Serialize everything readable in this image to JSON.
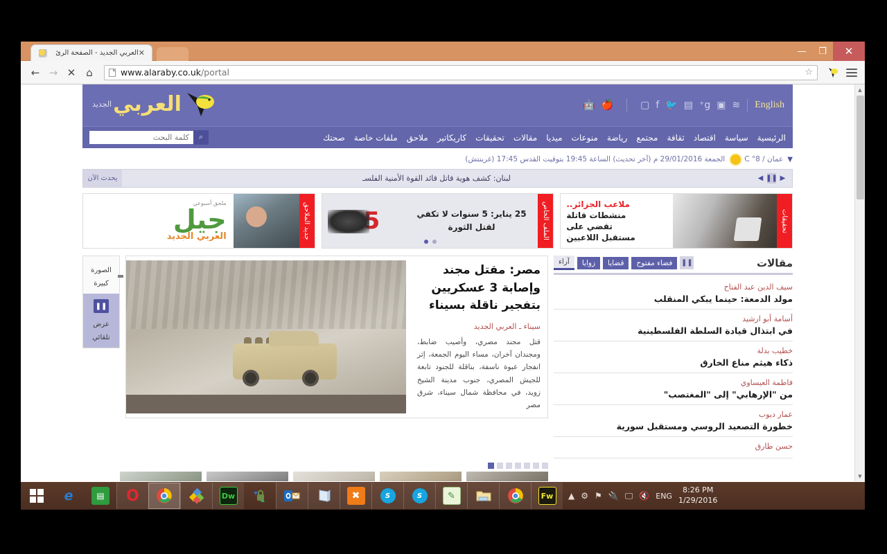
{
  "browser": {
    "tab_title": "العربي الجديد - الصفحة الرئ",
    "tab_close": "✕",
    "url_host": "www.alaraby.co.uk",
    "url_path": "/portal",
    "back": "←",
    "forward": "→",
    "stop": "✕",
    "home": "⌂",
    "minimize": "—",
    "maximize": "❐",
    "close": "✕"
  },
  "site": {
    "lang_link": "English",
    "logo_text": "العربي",
    "logo_sub": "الجديد",
    "social": [
      "rss-icon",
      "instagram-icon",
      "googleplus-icon",
      "youtube-icon",
      "twitter-icon",
      "facebook-icon",
      "camera-icon",
      "apple-icon",
      "android-icon"
    ],
    "social_glyphs": [
      "≈",
      "◙",
      "g+",
      "▶",
      "y",
      "f",
      "◉",
      "",
      "⋔"
    ],
    "nav": [
      "الرئيسية",
      "سياسة",
      "اقتصاد",
      "ثقافة",
      "مجتمع",
      "رياضة",
      "منوعات",
      "ميديا",
      "مقالات",
      "تحقيقات",
      "كاريكاتير",
      "ملاحق",
      "ملفات خاصة",
      "صحتك"
    ],
    "search_placeholder": "كلمة البحث",
    "search_icon": "⌕",
    "date_line": "الجمعة 29/01/2016 م (آخر تحديث) الساعة 19:45 بتوقيت القدس 17:45 (غرينتش)",
    "weather_city": "عمان / 8° C",
    "weather_chevron": "▼"
  },
  "ticker": {
    "label": "يحدث الآن",
    "headline": "لبنان: كشف هوية قاتل قائد القوة الأمنية الفلسـ",
    "prev": "◀",
    "pause": "❚❚",
    "next": "▶"
  },
  "banners": [
    {
      "tab": "تحقيقات",
      "line1": "ملاعب الجزائر..",
      "line2": "منشطات قاتلة",
      "line3": "تقضي على",
      "line4": "مستقبل اللاعبين"
    },
    {
      "tab": "الملف الخاص",
      "text": "25 يناير: 5 سنوات لا تكفي لقتل الثورة",
      "art_number": "25"
    },
    {
      "tab": "جديد الملاحق",
      "name": "جيل",
      "small": "ملحق أسبوعي",
      "logo": "العربي الجديد"
    }
  ],
  "articles": {
    "title": "مقالات",
    "pause": "❚❚",
    "tabs": [
      {
        "label": "آراء",
        "active": true
      },
      {
        "label": "زوايا",
        "active": false
      },
      {
        "label": "قضايا",
        "active": false
      },
      {
        "label": "فضاء مفتوح",
        "active": false
      }
    ],
    "items": [
      {
        "author": "سيف الدين عبد الفتاح",
        "title": "مولد الدمعة: حينما يبكي المنقلب"
      },
      {
        "author": "أسامة أبو ارشيد",
        "title": "في ابتذال قيادة السلطة الفلسطينية"
      },
      {
        "author": "خطيب بدلة",
        "title": "ذكاء هيثم مناع الخارق"
      },
      {
        "author": "فاطمة العيساوي",
        "title": "من \"الإرهابي\" إلى \"المغتصب\""
      },
      {
        "author": "عمار ديوب",
        "title": "خطورة التصعيد الروسي ومستقبل سورية"
      },
      {
        "author": "حسن طارق",
        "title": ""
      }
    ]
  },
  "feature": {
    "headline": "مصر: مقتل مجند وإصابة 3 عسكريين بتفجير ناقلة بسيناء",
    "byline": "سيناء ـ العربي الجديد",
    "body": "قتل مجند مصري، وأصيب ضابط، ومجندان آخران، مساء اليوم الجمعة، إثر انفجار عبوة ناسفة، بناقلة للجنود تابعة للجيش المصري، جنوب مدينة الشيخ زويد، في محافظة شمال سيناء، شرق مصر"
  },
  "rail": {
    "big_image_label": "الصورة كبيرة",
    "autoplay_label": "عرض تلقائي",
    "autoplay_glyph": "❚❚"
  },
  "carousel": {
    "dots_count": 7,
    "active_dot": 7,
    "prev_arrow": "‹",
    "next_arrow": "›"
  },
  "taskbar": {
    "start": "start-button",
    "apps": [
      {
        "name": "internet-explorer",
        "glyph": "e",
        "color": "#2a7bd0",
        "bg": "transparent",
        "active": false
      },
      {
        "name": "windows-store",
        "glyph": "▣",
        "color": "#ffffff",
        "bg": "#2e9b3f",
        "active": false
      },
      {
        "name": "opera",
        "glyph": "O",
        "color": "#ffffff",
        "bg": "#e0282e",
        "active": false
      },
      {
        "name": "google-chrome",
        "glyph": "◉",
        "color": "#ffffff",
        "bg": "#4f9e4f",
        "active": true
      },
      {
        "name": "color-app",
        "glyph": "◆",
        "color": "#ffffff",
        "bg": "#d66a8a",
        "active": false
      },
      {
        "name": "dreamweaver",
        "glyph": "Dw",
        "color": "#3ec93e",
        "bg": "#0d240d",
        "active": false
      },
      {
        "name": "sync-lock",
        "glyph": "🔒",
        "color": "#ffffff",
        "bg": "transparent",
        "active": false
      },
      {
        "name": "outlook",
        "glyph": "O",
        "color": "#ffffff",
        "bg": "#1b6ec2",
        "active": false
      },
      {
        "name": "notepad",
        "glyph": "▤",
        "color": "#6f9fd8",
        "bg": "#dfeaf7",
        "active": false
      },
      {
        "name": "xampp",
        "glyph": "✖",
        "color": "#ffffff",
        "bg": "#f07c18",
        "active": false
      },
      {
        "name": "skype-one",
        "glyph": "S",
        "color": "#ffffff",
        "bg": "#16a5e0",
        "active": false
      },
      {
        "name": "skype-two",
        "glyph": "S",
        "color": "#ffffff",
        "bg": "#16a5e0",
        "active": false
      },
      {
        "name": "notepad-plus-plus",
        "glyph": "✎",
        "color": "#3b8c3b",
        "bg": "#e8f2d8",
        "active": false
      },
      {
        "name": "file-explorer",
        "glyph": "🗀",
        "color": "#e0b04a",
        "bg": "#f4dfa8",
        "active": false
      },
      {
        "name": "chrome-second",
        "glyph": "◉",
        "color": "#ffffff",
        "bg": "#4f9e4f",
        "active": false
      },
      {
        "name": "fireworks",
        "glyph": "Fw",
        "color": "#f2e52c",
        "bg": "#1a1a0d",
        "active": false
      }
    ],
    "tray": {
      "overflow": "▲",
      "icons": [
        "settings-icon",
        "network-flag-icon",
        "device-icon",
        "display-icon",
        "volume-muted-icon"
      ],
      "language": "ENG",
      "time": "8:26 PM",
      "date": "1/29/2016"
    }
  }
}
